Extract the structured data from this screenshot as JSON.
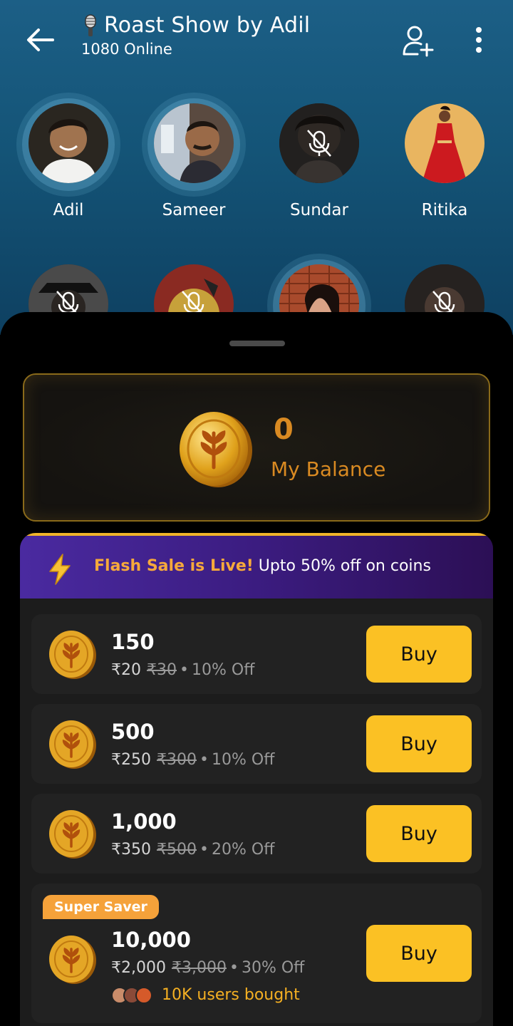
{
  "header": {
    "title": "Roast Show by Adil",
    "online": "1080 Online"
  },
  "speakers": [
    {
      "name": "Adil",
      "muted": false
    },
    {
      "name": "Sameer",
      "muted": false
    },
    {
      "name": "Sundar",
      "muted": true
    },
    {
      "name": "Ritika",
      "muted": false
    }
  ],
  "balance": {
    "value": "0",
    "label": "My Balance"
  },
  "flash_sale": {
    "highlight": "Flash Sale is Live!",
    "text": "Upto 50% off on coins"
  },
  "packs": [
    {
      "coins": "150",
      "price": "₹20",
      "old_price": "₹30",
      "off": "10% Off",
      "buy_label": "Buy"
    },
    {
      "coins": "500",
      "price": "₹250",
      "old_price": "₹300",
      "off": "10% Off",
      "buy_label": "Buy"
    },
    {
      "coins": "1,000",
      "price": "₹350",
      "old_price": "₹500",
      "off": "20% Off",
      "buy_label": "Buy"
    },
    {
      "coins": "10,000",
      "price": "₹2,000",
      "old_price": "₹3,000",
      "off": "30% Off",
      "buy_label": "Buy",
      "badge": "Super Saver",
      "buyers": "10K users bought"
    }
  ],
  "colors": {
    "accent_yellow": "#fbc124",
    "balance_orange": "#d98a22",
    "badge_orange": "#f5a23a",
    "banner_purple": "#3b1c80"
  }
}
